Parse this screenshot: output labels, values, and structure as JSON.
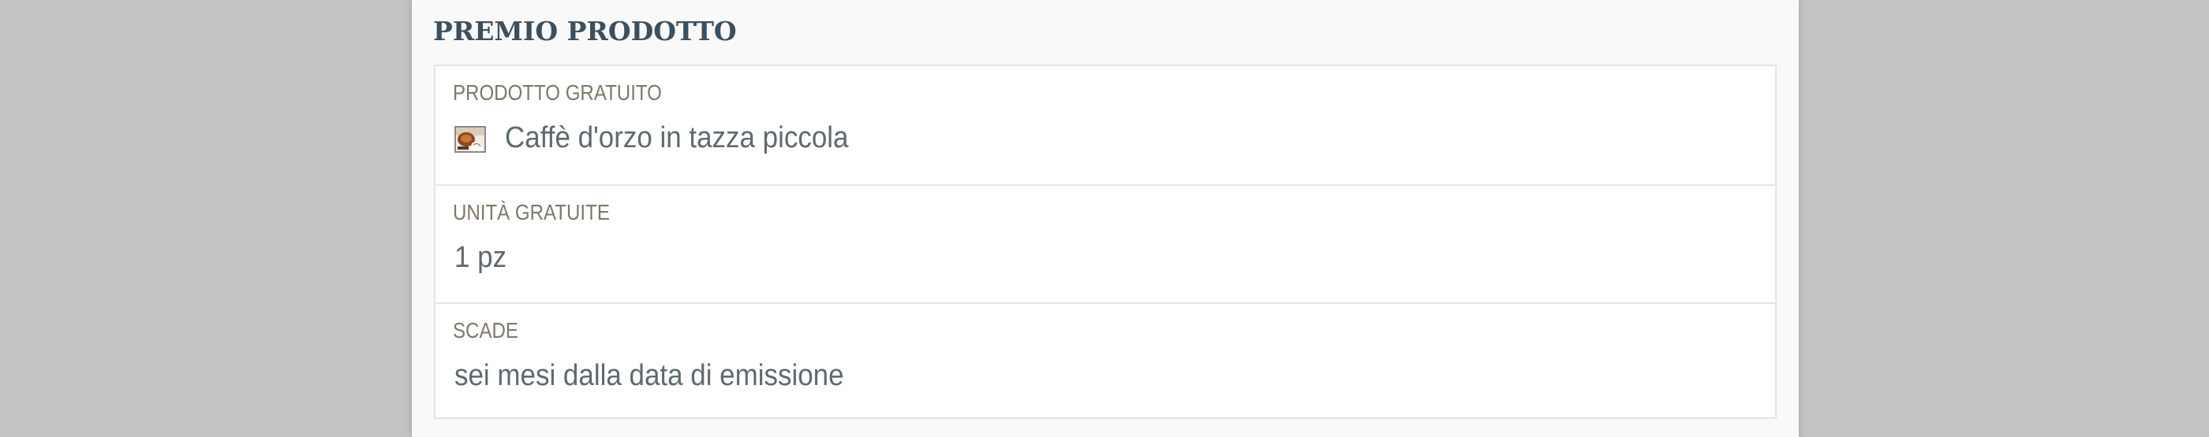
{
  "section": {
    "title": "PREMIO PRODOTTO"
  },
  "fields": [
    {
      "label": "PRODOTTO GRATUITO",
      "value": "Caffè d'orzo in tazza piccola",
      "icon": "coffee-cup-thumbnail-icon"
    },
    {
      "label": "UNITÀ GRATUITE",
      "value": "1 pz"
    },
    {
      "label": "SCADE",
      "value": "sei mesi dalla data di emissione"
    }
  ],
  "colors": {
    "page_background": "#c3c3c2",
    "panel_background": "#f9f9f9",
    "title": "#3d4f5d",
    "label": "#7d7868",
    "value": "#5e6a6f",
    "border": "#e4e4e4"
  }
}
